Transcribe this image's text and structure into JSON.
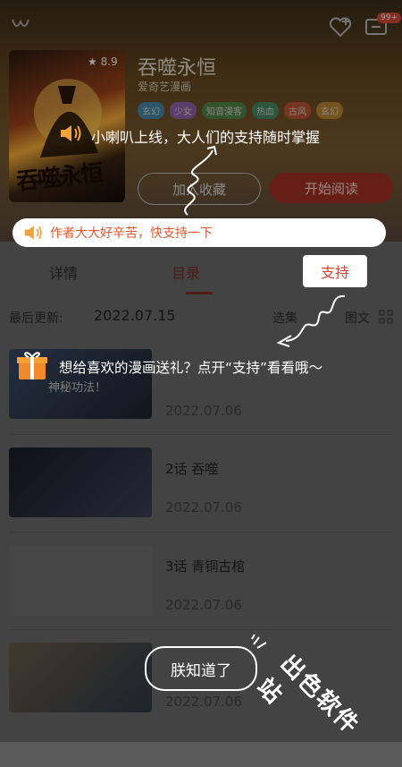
{
  "header": {
    "message_badge": "99+"
  },
  "book": {
    "rating": "8.9",
    "title": "吞噬永恒",
    "author": "爱奇艺漫画",
    "tags": [
      {
        "label": "玄幻",
        "color": "#3a9bd9"
      },
      {
        "label": "少女",
        "color": "#a36ad9"
      },
      {
        "label": "知音漫客",
        "color": "#4a9a5b"
      },
      {
        "label": "热血",
        "color": "#3aa07a"
      },
      {
        "label": "古风",
        "color": "#d9593a"
      },
      {
        "label": "玄幻",
        "color": "#d99a3a"
      }
    ],
    "cover_text": "吞噬永恒"
  },
  "actions": {
    "add_shelf": "加入收藏",
    "start_read": "开始阅读"
  },
  "tabs": [
    {
      "label": "详情"
    },
    {
      "label": "目录"
    }
  ],
  "catalog": {
    "last_update_label": "最后更新:",
    "last_update_date": "2022.07.15",
    "select_label": "选集",
    "text_mode_label": "图文"
  },
  "chapters": [
    {
      "title": "",
      "date": "2022.07.06",
      "thumb_caption": "神秘功法！"
    },
    {
      "title": "2话  吞噬",
      "date": "2022.07.06",
      "thumb_caption": ""
    },
    {
      "title": "3话  青铜古棺",
      "date": "2022.07.06",
      "thumb_caption": ""
    },
    {
      "title": "",
      "date": "2022.07.06",
      "thumb_caption": ""
    }
  ],
  "guide": {
    "speaker_tip": "小喇叭上线，大人们的支持随时掌握",
    "notice": "作者大大好辛苦，快支持一下",
    "support_button": "支持",
    "gift_tip": "想给喜欢的漫画送礼？点开“支持”看看哦～",
    "ok_button": "朕知道了"
  },
  "watermark": "出色软件站",
  "colors": {
    "accent_red": "#d6432f",
    "notice_orange": "#e4572e",
    "gift_orange": "#f2892b"
  }
}
